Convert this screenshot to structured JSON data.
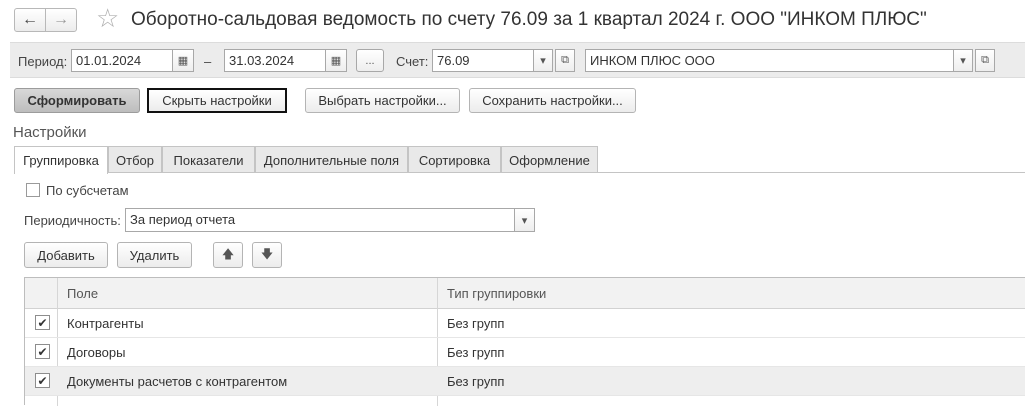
{
  "header": {
    "title": "Оборотно-сальдовая ведомость по счету 76.09 за 1 квартал 2024 г. ООО \"ИНКОМ ПЛЮС\"",
    "back_icon": "←",
    "forward_icon": "→",
    "favorite_icon": "☆"
  },
  "params": {
    "period_label": "Период:",
    "date_from": "01.01.2024",
    "dash": "–",
    "date_to": "31.03.2024",
    "dots_label": "...",
    "account_label": "Счет:",
    "account_value": "76.09",
    "org_value": "ИНКОМ ПЛЮС ООО",
    "calendar_icon": "▦",
    "dropdown_icon": "▾",
    "open_icon": "⧉"
  },
  "actions": {
    "generate": "Сформировать",
    "hide_settings": "Скрыть настройки",
    "choose_settings": "Выбрать настройки...",
    "save_settings": "Сохранить настройки..."
  },
  "settings": {
    "title": "Настройки",
    "tabs": [
      "Группировка",
      "Отбор",
      "Показатели",
      "Дополнительные поля",
      "Сортировка",
      "Оформление"
    ],
    "by_subaccounts": "По субсчетам",
    "periodicity_label": "Периодичность:",
    "periodicity_value": "За период отчета",
    "add": "Добавить",
    "delete": "Удалить",
    "up_icon": "🡅",
    "down_icon": "🡇"
  },
  "table": {
    "columns": [
      "Поле",
      "Тип группировки"
    ],
    "rows": [
      {
        "field": "Контрагенты",
        "type": "Без групп",
        "checked": true
      },
      {
        "field": "Договоры",
        "type": "Без групп",
        "checked": true
      },
      {
        "field": "Документы расчетов с контрагентом",
        "type": "Без групп",
        "checked": true
      }
    ],
    "check_mark": "✔"
  }
}
